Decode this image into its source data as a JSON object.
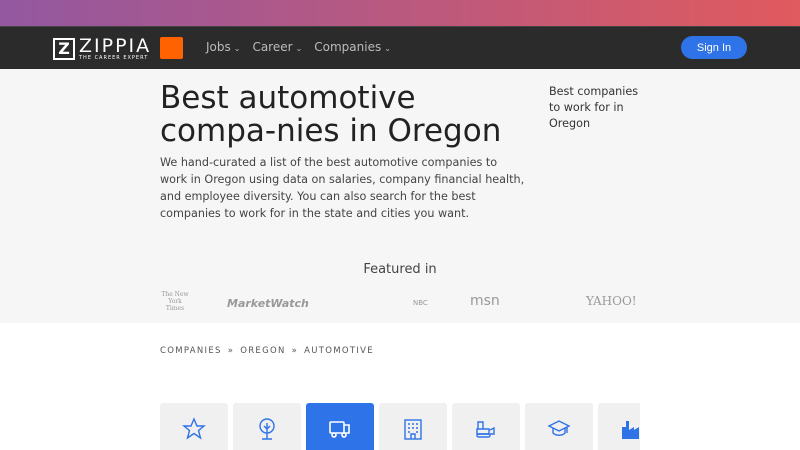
{
  "nav": {
    "logo": "ZIPPIA",
    "logo_tagline": "THE CAREER EXPERT",
    "menu": [
      {
        "label": "Jobs"
      },
      {
        "label": "Career"
      },
      {
        "label": "Companies"
      }
    ],
    "sign_in": "Sign In"
  },
  "hero": {
    "title": "Best automotive compa-nies in Oregon",
    "description": "We hand-curated a list of the best automotive companies to work in Oregon using data on salaries, company financial health, and employee diversity. You can also search for the best companies to work for in the state and cities you want.",
    "side_link": "Best companies to work for in Oregon",
    "featured_label": "Featured in",
    "press": [
      "The New York Times",
      "MarketWatch",
      "NBC",
      "msn",
      "YAHOO!"
    ]
  },
  "breadcrumb": [
    "COMPANIES",
    "OREGON",
    "AUTOMOTIVE"
  ],
  "categories": [
    {
      "icon": "star-icon"
    },
    {
      "icon": "tree-icon"
    },
    {
      "icon": "truck-icon",
      "active": true
    },
    {
      "icon": "building-icon"
    },
    {
      "icon": "bulldozer-icon"
    },
    {
      "icon": "graduation-cap-icon"
    },
    {
      "icon": "factory-icon"
    }
  ],
  "colors": {
    "accent": "#2f73e8",
    "brand_orange": "#ff6200",
    "gradient_start": "#9358a0",
    "gradient_end": "#e05a5e"
  }
}
